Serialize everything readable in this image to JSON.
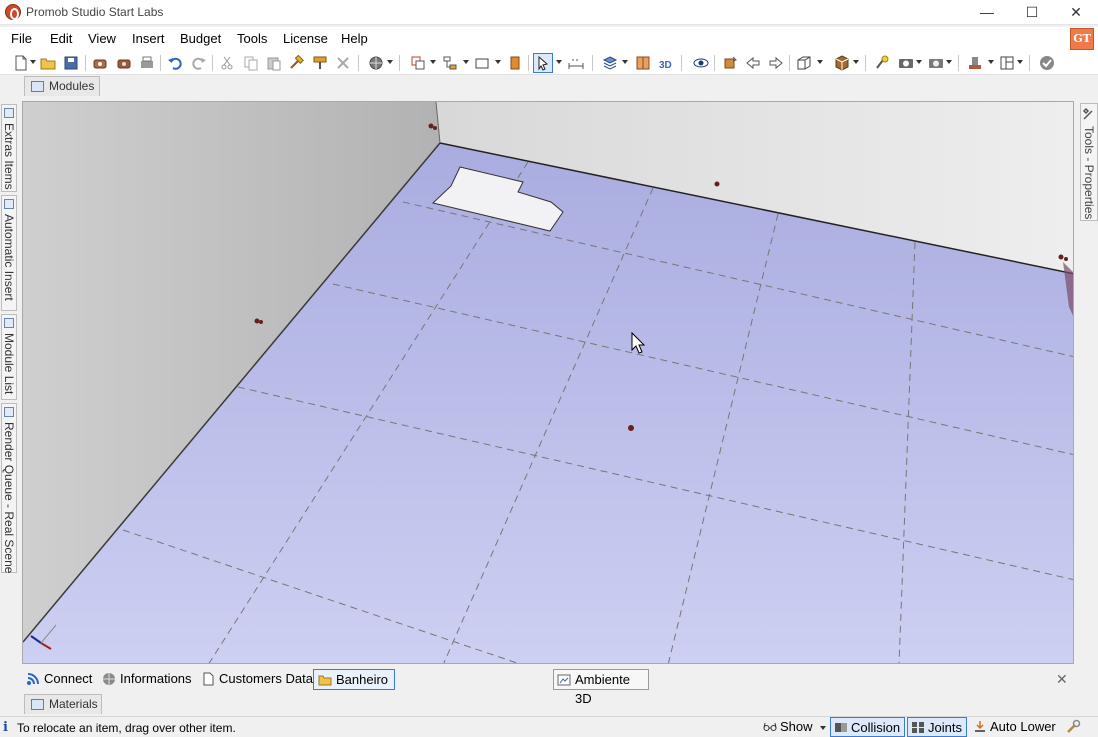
{
  "window": {
    "title": "Promob Studio Start Labs",
    "minimize_glyph": "—",
    "maximize_glyph": "☐",
    "close_glyph": "✕"
  },
  "menu": {
    "items": [
      "File",
      "Edit",
      "View",
      "Insert",
      "Budget",
      "Tools",
      "License",
      "Help"
    ],
    "user_badge": "GT"
  },
  "toolbar": {
    "icons": [
      "new-file-icon",
      "open-folder-icon",
      "save-icon",
      "render-icon",
      "render-alt-icon",
      "print-icon",
      "undo-icon",
      "redo-icon",
      "cut-icon",
      "copy-icon",
      "paste-icon",
      "hammer-icon",
      "paint-icon",
      "delete-icon",
      "globe-icon",
      "group-icon",
      "hierarchy-icon",
      "rectangle-icon",
      "door-icon",
      "select-cursor-icon",
      "measure-icon",
      "layers-icon",
      "cabinet-icon",
      "3d-icon",
      "eye-icon",
      "rotate-icon",
      "move-left-icon",
      "move-right-icon",
      "box-view-icon",
      "cube-icon",
      "light-icon",
      "camera-icon",
      "camera-alt-icon",
      "stamp-icon",
      "panels-icon",
      "check-icon"
    ]
  },
  "panels": {
    "modules_label": "Modules",
    "materials_label": "Materials",
    "left_tabs": [
      "Extras Items",
      "Automatic Insert",
      "Module List",
      "Render Queue - Real Scene"
    ],
    "right_tab": "Tools - Properties"
  },
  "bottom_tabs": {
    "items": [
      "Connect",
      "Informations",
      "Customers Data",
      "Banheiro"
    ],
    "active": "Banheiro",
    "view_tab": "Ambiente 3D",
    "close_glyph": "✕"
  },
  "status": {
    "info_glyph": "i",
    "message": "To relocate an item, drag over other item.",
    "show_label": "Show",
    "collision_label": "Collision",
    "joints_label": "Joints",
    "auto_lower_label": "Auto Lower"
  },
  "colors": {
    "floor": "#b9bce6",
    "wall_left": "#bdbdbd",
    "wall_back": "#e4e4e4",
    "accent": "#3a7bd5",
    "badge": "#f07a4a"
  }
}
